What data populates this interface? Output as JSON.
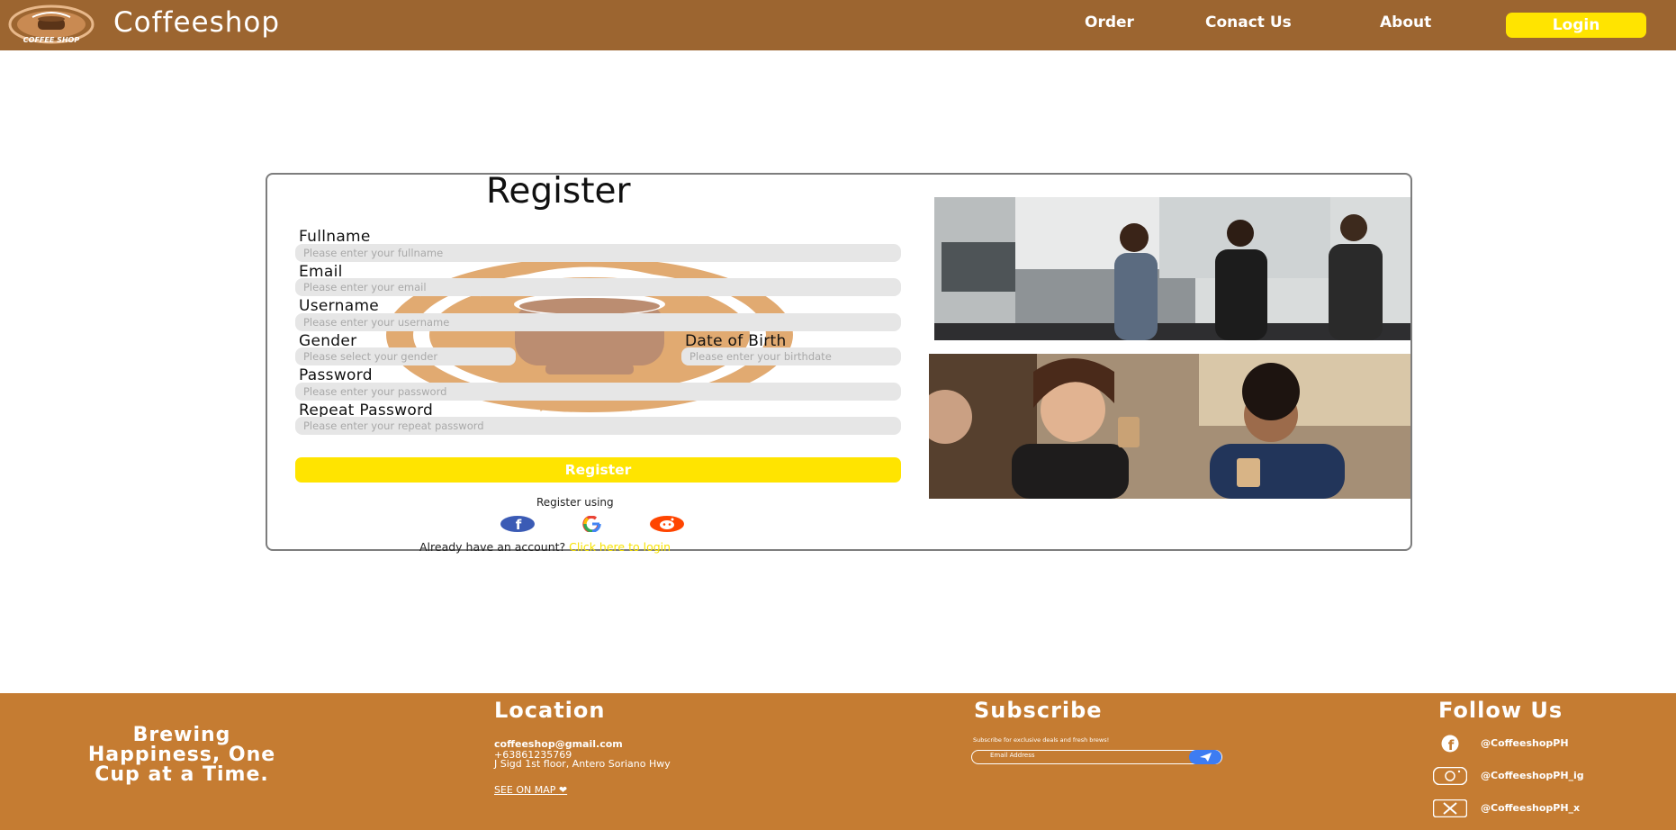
{
  "header": {
    "brand": "Coffeeshop",
    "logo_text": "COFFEE SHOP",
    "nav": [
      "Order",
      "Conact Us",
      "About"
    ],
    "login_label": "Login"
  },
  "register": {
    "title": "Register",
    "fields": {
      "fullname": {
        "label": "Fullname",
        "placeholder": "Please enter your fullname"
      },
      "email": {
        "label": "Email",
        "placeholder": "Please enter your email"
      },
      "username": {
        "label": "Username",
        "placeholder": "Please enter your username"
      },
      "gender": {
        "label": "Gender",
        "placeholder": "Please select your gender"
      },
      "dob": {
        "label": "Date of Birth",
        "placeholder": "Please enter your birthdate"
      },
      "password": {
        "label": "Password",
        "placeholder": "Please enter your password"
      },
      "repeat": {
        "label": "Repeat Password",
        "placeholder": "Please enter your repeat password"
      }
    },
    "submit_label": "Register",
    "register_using": "Register using",
    "social": [
      "facebook-icon",
      "google-icon",
      "reddit-icon"
    ],
    "already_text": "Already have an account?",
    "login_link": "Click here to login"
  },
  "footer": {
    "tagline": "Brewing Happiness, One Cup at a Time.",
    "location": {
      "heading": "Location",
      "email": "coffeeshop@gmail.com",
      "phone": "+63861235769",
      "address": "J Sigd 1st floor, Antero Soriano Hwy",
      "map_link": "SEE ON MAP"
    },
    "subscribe": {
      "heading": "Subscribe",
      "text": "Subscribe for exclusive deals and fresh brews!",
      "placeholder": "Email Address"
    },
    "follow": {
      "heading": "Follow Us",
      "items": [
        "@CoffeeshopPH",
        "@CoffeeshopPH_ig",
        "@CoffeeshopPH_x"
      ]
    }
  },
  "colors": {
    "header_bg": "#9c6530",
    "footer_bg": "#c57c32",
    "accent_yellow": "#ffe400"
  }
}
